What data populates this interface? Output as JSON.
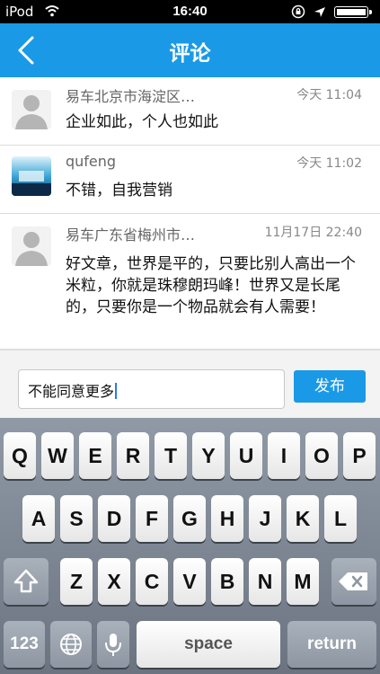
{
  "status_bar": {
    "carrier": "iPod",
    "time": "16:40",
    "wifi_icon": "wifi-icon",
    "lock_icon": "rotation-lock-icon",
    "battery_icon": "battery-icon"
  },
  "nav": {
    "title": "评论",
    "back_icon": "chevron-left-icon"
  },
  "comments": [
    {
      "name": "易车北京市海淀区…",
      "time": "今天 11:04",
      "text": "企业如此，个人也如此",
      "avatar": "default-avatar"
    },
    {
      "name": "qufeng",
      "time": "今天 11:02",
      "text": "不错，自我营销",
      "avatar": "photo-avatar"
    },
    {
      "name": "易车广东省梅州市…",
      "time": "11月17日 22:40",
      "text": "好文章，世界是平的，只要比别人高出一个米粒，你就是珠穆朗玛峰！世界又是长尾的，只要你是一个物品就会有人需要！",
      "avatar": "default-avatar"
    }
  ],
  "input": {
    "value": "不能同意更多",
    "publish_label": "发布"
  },
  "keyboard": {
    "row1": [
      "Q",
      "W",
      "E",
      "R",
      "T",
      "Y",
      "U",
      "I",
      "O",
      "P"
    ],
    "row2": [
      "A",
      "S",
      "D",
      "F",
      "G",
      "H",
      "J",
      "K",
      "L"
    ],
    "row3": [
      "Z",
      "X",
      "C",
      "V",
      "B",
      "N",
      "M"
    ],
    "shift_icon": "shift-icon",
    "delete_icon": "backspace-icon",
    "numbers_label": "123",
    "globe_icon": "globe-icon",
    "mic_icon": "microphone-icon",
    "space_label": "space",
    "return_label": "return"
  },
  "colors": {
    "accent": "#1a9ae6",
    "status_bar": "#000000",
    "keyboard_bg": "#7c8591"
  }
}
